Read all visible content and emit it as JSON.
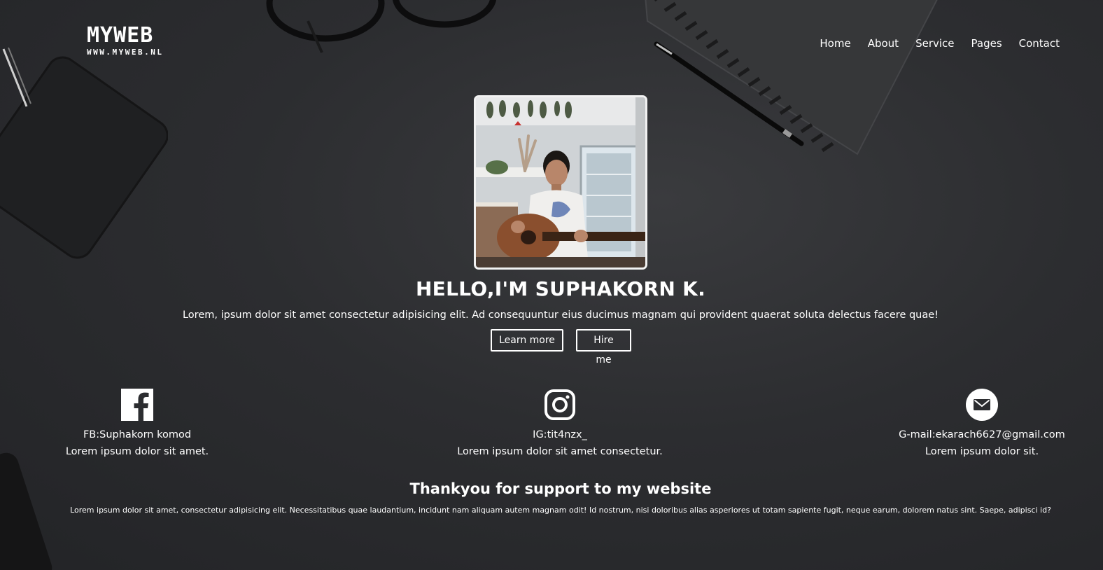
{
  "header": {
    "logo_main": "MYWEB",
    "logo_sub": "WWW.MYWEB.NL",
    "nav": [
      "Home",
      "About",
      "Service",
      "Pages",
      "Contact"
    ]
  },
  "hero": {
    "title": "HELLO,I'M SUPHAKORN K.",
    "text": "Lorem, ipsum dolor sit amet consectetur adipisicing elit. Ad consequuntur eius ducimus magnam qui provident quaerat soluta delectus facere quae!",
    "learn_more_label": "Learn more",
    "hire_me_label": "Hire me",
    "photo_alt": "Portrait of a person holding a guitar"
  },
  "contacts": [
    {
      "icon": "facebook-icon",
      "handle": "FB:Suphakorn komod",
      "desc": "Lorem ipsum dolor sit amet."
    },
    {
      "icon": "instagram-icon",
      "handle": "IG:tit4nzx_",
      "desc": "Lorem ipsum dolor sit amet consectetur."
    },
    {
      "icon": "mail-icon",
      "handle": "G-mail:ekarach6627@gmail.com",
      "desc": "Lorem ipsum dolor sit."
    }
  ],
  "footer": {
    "thanks": "Thankyou for support to my website",
    "text": "Lorem ipsum dolor sit amet, consectetur adipisicing elit. Necessitatibus quae laudantium, incidunt nam aliquam autem magnam odit! Id nostrum, nisi doloribus alias asperiores ut totam sapiente fugit, neque earum, dolorem natus sint. Saepe, adipisci id?"
  },
  "colors": {
    "background": "#2c2d30",
    "text": "#ffffff",
    "button_border": "#ffffff"
  }
}
